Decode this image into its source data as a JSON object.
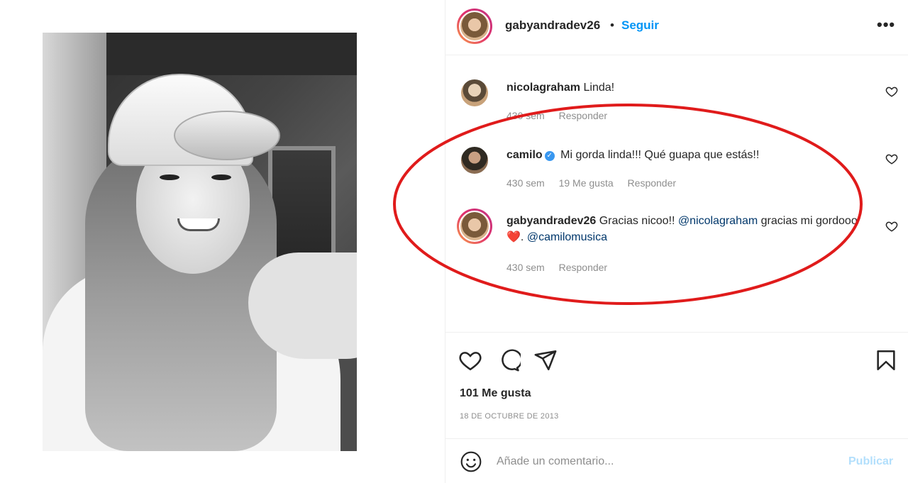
{
  "post": {
    "photo_alt": "Selfie en blanco y negro",
    "author": "gabyandradev26",
    "separator": "•",
    "follow_label": "Seguir",
    "more_label": "•••"
  },
  "comments": [
    {
      "username": "nicolagraham",
      "text": "Linda!",
      "time": "430 sem",
      "likes": "",
      "reply_label": "Responder",
      "verified": false
    },
    {
      "username": "camilo",
      "text": "Mi gorda linda!!! Qué guapa que estás!!",
      "time": "430 sem",
      "likes": "19 Me gusta",
      "reply_label": "Responder",
      "verified": true
    },
    {
      "username": "gabyandradev26",
      "text_part1": "Gracias nicoo!!",
      "mention1": "@nicolagraham",
      "text_part2": "gracias mi gordooo",
      "emoji": "❤️",
      "text_part3": ".",
      "mention2": "@camilomusica",
      "time": "430 sem",
      "reply_label": "Responder",
      "verified": false
    }
  ],
  "actions": {
    "like_icon": "heart-icon",
    "comment_icon": "comment-bubble-icon",
    "share_icon": "paper-plane-icon",
    "save_icon": "bookmark-icon"
  },
  "likes_text": "101 Me gusta",
  "date_text": "18 DE OCTUBRE DE 2013",
  "add_comment": {
    "placeholder": "Añade un comentario...",
    "publish_label": "Publicar"
  },
  "colors": {
    "follow": "#0095f6",
    "mention": "#00376b",
    "publish_disabled": "#b2dffc",
    "annotation": "#e01b1b"
  }
}
